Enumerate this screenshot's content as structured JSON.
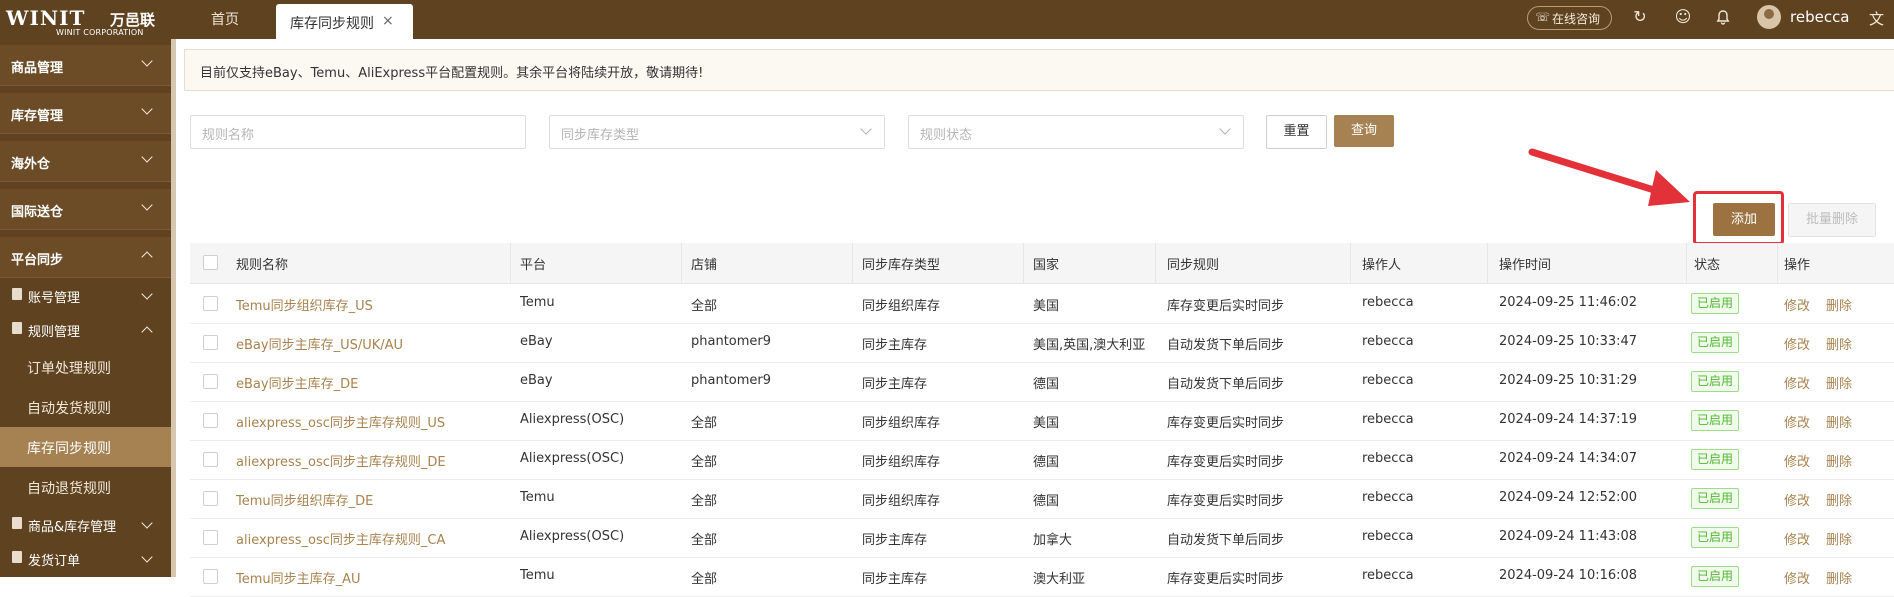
{
  "topbar": {
    "logo_main": "WINIT",
    "logo_cn": "万邑联",
    "logo_sub": "WINIT CORPORATION",
    "tabs": [
      {
        "label": "首页"
      },
      {
        "label": "库存同步规则",
        "active": true
      }
    ],
    "close_glyph": "×",
    "consult_label": "在线咨询",
    "username": "rebecca",
    "icons": [
      "refresh-icon",
      "feedback-icon",
      "bell-icon",
      "translate-icon"
    ]
  },
  "sidebar": {
    "groups": [
      {
        "label": "商品管理"
      },
      {
        "label": "库存管理"
      },
      {
        "label": "海外仓"
      },
      {
        "label": "国际送仓"
      },
      {
        "label": "平台同步",
        "expanded": true
      }
    ],
    "subgroups": [
      {
        "label": "账号管理"
      },
      {
        "label": "规则管理",
        "expanded": true
      },
      {
        "label": "商品&库存管理"
      },
      {
        "label": "发货订单"
      }
    ],
    "leaves": [
      {
        "label": "订单处理规则"
      },
      {
        "label": "自动发货规则"
      },
      {
        "label": "库存同步规则",
        "active": true
      },
      {
        "label": "自动退货规则"
      }
    ]
  },
  "notice": "目前仅支持eBay、Temu、AliExpress平台配置规则。其余平台将陆续开放，敬请期待!",
  "filters": {
    "rule_name_placeholder": "规则名称",
    "sync_type_placeholder": "同步库存类型",
    "rule_status_placeholder": "规则状态",
    "reset_label": "重置",
    "query_label": "查询"
  },
  "actions": {
    "add_label": "添加",
    "batch_delete_label": "批量删除"
  },
  "table": {
    "headers": [
      "规则名称",
      "平台",
      "店铺",
      "同步库存类型",
      "国家",
      "同步规则",
      "操作人",
      "操作时间",
      "状态",
      "操作"
    ],
    "edit_label": "修改",
    "delete_label": "删除",
    "rows": [
      {
        "name": "Temu同步组织库存_US",
        "platform": "Temu",
        "store": "全部",
        "type": "同步组织库存",
        "country": "美国",
        "rule": "库存变更后实时同步",
        "operator": "rebecca",
        "time": "2024-09-25 11:46:02",
        "status": "已启用"
      },
      {
        "name": "eBay同步主库存_US/UK/AU",
        "platform": "eBay",
        "store": "phantomer9",
        "type": "同步主库存",
        "country": "美国,英国,澳大利亚",
        "rule": "自动发货下单后同步",
        "operator": "rebecca",
        "time": "2024-09-25 10:33:47",
        "status": "已启用"
      },
      {
        "name": "eBay同步主库存_DE",
        "platform": "eBay",
        "store": "phantomer9",
        "type": "同步主库存",
        "country": "德国",
        "rule": "自动发货下单后同步",
        "operator": "rebecca",
        "time": "2024-09-25 10:31:29",
        "status": "已启用"
      },
      {
        "name": "aliexpress_osc同步主库存规则_US",
        "platform": "Aliexpress(OSC)",
        "store": "全部",
        "type": "同步组织库存",
        "country": "美国",
        "rule": "库存变更后实时同步",
        "operator": "rebecca",
        "time": "2024-09-24 14:37:19",
        "status": "已启用"
      },
      {
        "name": "aliexpress_osc同步主库存规则_DE",
        "platform": "Aliexpress(OSC)",
        "store": "全部",
        "type": "同步组织库存",
        "country": "德国",
        "rule": "库存变更后实时同步",
        "operator": "rebecca",
        "time": "2024-09-24 14:34:07",
        "status": "已启用"
      },
      {
        "name": "Temu同步组织库存_DE",
        "platform": "Temu",
        "store": "全部",
        "type": "同步组织库存",
        "country": "德国",
        "rule": "库存变更后实时同步",
        "operator": "rebecca",
        "time": "2024-09-24 12:52:00",
        "status": "已启用"
      },
      {
        "name": "aliexpress_osc同步主库存规则_CA",
        "platform": "Aliexpress(OSC)",
        "store": "全部",
        "type": "同步主库存",
        "country": "加拿大",
        "rule": "自动发货下单后同步",
        "operator": "rebecca",
        "time": "2024-09-24 11:43:08",
        "status": "已启用"
      },
      {
        "name": "Temu同步主库存_AU",
        "platform": "Temu",
        "store": "全部",
        "type": "同步主库存",
        "country": "澳大利亚",
        "rule": "库存变更后实时同步",
        "operator": "rebecca",
        "time": "2024-09-24 10:16:08",
        "status": "已启用"
      }
    ]
  },
  "colors": {
    "brand_dark": "#5f4321",
    "brand": "#a68152",
    "link": "#a8834f",
    "highlight": "#e3313a",
    "status_green": "#52b733"
  }
}
